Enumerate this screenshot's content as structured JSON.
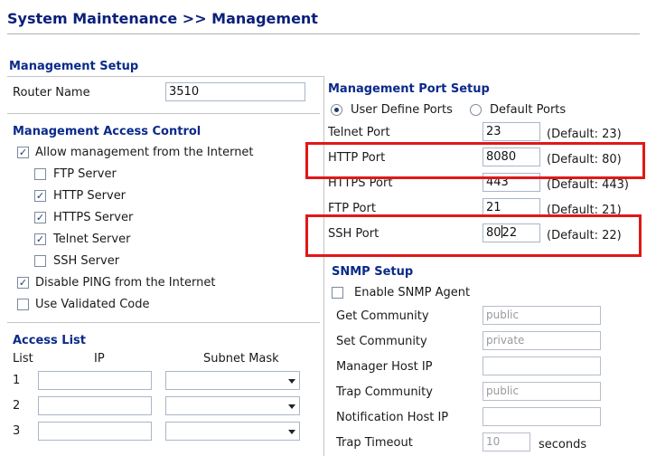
{
  "page": {
    "title": "System Maintenance >> Management"
  },
  "management_setup": {
    "heading": "Management Setup",
    "router_name_label": "Router Name",
    "router_name_value": "3510"
  },
  "access_control": {
    "heading": "Management Access Control",
    "items": [
      {
        "label": "Allow management from the Internet",
        "checked": true
      },
      {
        "label": "FTP Server",
        "checked": false
      },
      {
        "label": "HTTP Server",
        "checked": true
      },
      {
        "label": "HTTPS Server",
        "checked": true
      },
      {
        "label": "Telnet Server",
        "checked": true
      },
      {
        "label": "SSH Server",
        "checked": false
      },
      {
        "label": "Disable PING from the Internet",
        "checked": true
      },
      {
        "label": "Use Validated Code",
        "checked": false
      }
    ]
  },
  "access_list": {
    "heading": "Access List",
    "col_list": "List",
    "col_ip": "IP",
    "col_mask": "Subnet Mask",
    "rows": [
      "1",
      "2",
      "3"
    ]
  },
  "port_setup": {
    "heading": "Management Port Setup",
    "radio_user": "User Define Ports",
    "radio_default": "Default Ports",
    "ports": [
      {
        "label": "Telnet Port",
        "value": "23",
        "default": "(Default: 23)"
      },
      {
        "label": "HTTP Port",
        "value": "8080",
        "default": "(Default: 80)"
      },
      {
        "label": "HTTPS Port",
        "value": "443",
        "default": "(Default: 443)"
      },
      {
        "label": "FTP Port",
        "value": "21",
        "default": "(Default: 21)"
      },
      {
        "label": "SSH Port",
        "value_before_cursor": "80",
        "value_after_cursor": "22",
        "default": "(Default: 22)"
      }
    ]
  },
  "snmp": {
    "heading": "SNMP Setup",
    "enable_label": "Enable SNMP Agent",
    "fields": [
      {
        "label": "Get Community",
        "value": "public"
      },
      {
        "label": "Set Community",
        "value": "private"
      },
      {
        "label": "Manager Host IP",
        "value": ""
      },
      {
        "label": "Trap Community",
        "value": "public"
      },
      {
        "label": "Notification Host IP",
        "value": ""
      },
      {
        "label": "Trap Timeout",
        "value": "10",
        "unit": "seconds"
      }
    ]
  },
  "colors": {
    "heading": "#0a2a8a",
    "highlight": "#e01818"
  }
}
